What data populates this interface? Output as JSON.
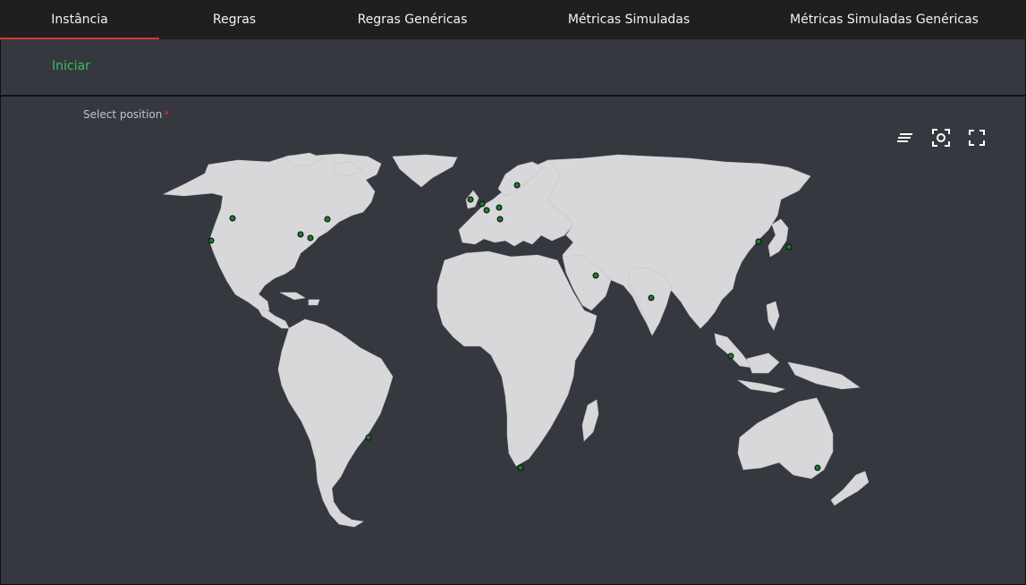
{
  "tabs": [
    {
      "label": "Instância",
      "active": true
    },
    {
      "label": "Regras",
      "active": false
    },
    {
      "label": "Regras Genéricas",
      "active": false
    },
    {
      "label": "Métricas Simuladas",
      "active": false
    },
    {
      "label": "Métricas Simuladas Genéricas",
      "active": false
    }
  ],
  "start": {
    "label": "Iniciar"
  },
  "map": {
    "label": "Select position",
    "required_mark": "*",
    "toolbar": {
      "legend_icon": "lines-icon",
      "focus_icon": "target-frame-icon",
      "fullscreen_icon": "fullscreen-icon"
    }
  },
  "colors": {
    "accent": "#e03131",
    "start": "#3dbd57",
    "marker": "#1f7a2c",
    "land": "#d8d8da",
    "panel": "#363840"
  }
}
